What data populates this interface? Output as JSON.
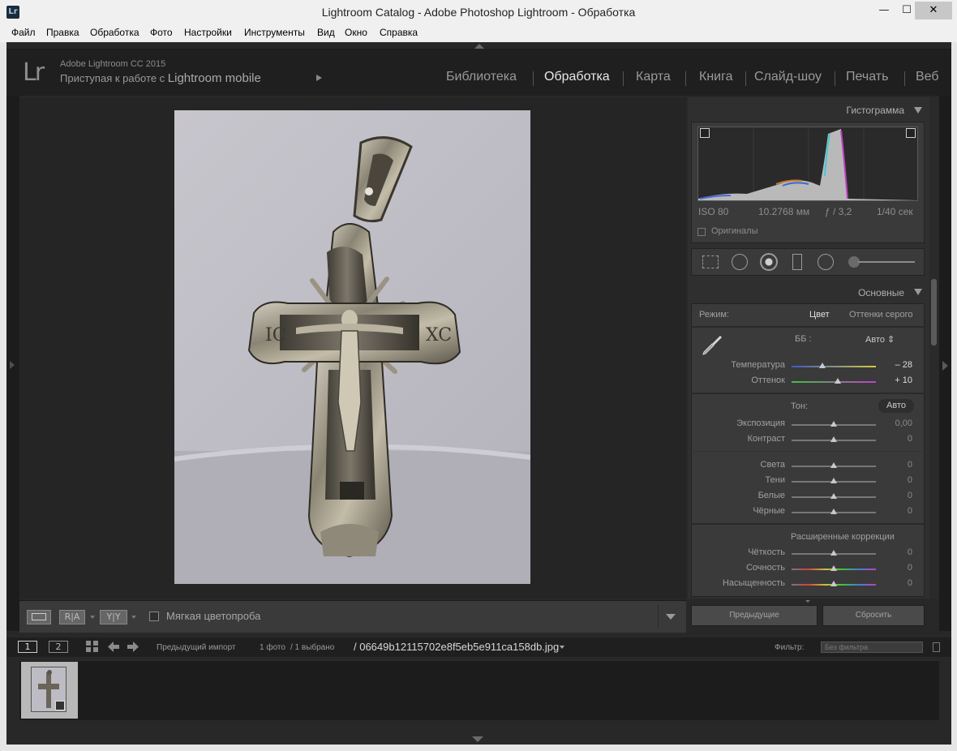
{
  "window": {
    "app_icon_text": "Lr",
    "title": "Lightroom Catalog - Adobe Photoshop Lightroom - Обработка",
    "minimize_glyph": "—",
    "maximize_glyph": "☐",
    "close_glyph": "✕"
  },
  "menu": [
    "Файл",
    "Правка",
    "Обработка",
    "Фото",
    "Настройки",
    "Инструменты",
    "Вид",
    "Окно",
    "Справка"
  ],
  "identity": {
    "logo": "Lr",
    "version": "Adobe Lightroom CC 2015",
    "tagline_prefix": "Приступая к работе с",
    "tagline_product": "Lightroom mobile"
  },
  "modules": [
    {
      "label": "Библиотека",
      "active": false
    },
    {
      "label": "Обработка",
      "active": true
    },
    {
      "label": "Карта",
      "active": false
    },
    {
      "label": "Книга",
      "active": false
    },
    {
      "label": "Слайд-шоу",
      "active": false
    },
    {
      "label": "Печать",
      "active": false
    },
    {
      "label": "Веб",
      "active": false
    }
  ],
  "toolbar": {
    "view_before_after_1": "R|A",
    "view_before_after_2": "Y|Y",
    "softproof_label": "Мягкая цветопроба",
    "softproof_checked": false
  },
  "histogram": {
    "title": "Гистограмма",
    "iso": "ISO 80",
    "focal": "10.2768 мм",
    "aperture": "ƒ / 3,2",
    "shutter": "1/40 сек",
    "originals_label": "Оригиналы"
  },
  "tools": [
    "crop-overlay-icon",
    "spot-removal-icon",
    "red-eye-icon",
    "graduated-filter-icon",
    "radial-filter-icon",
    "adjustment-brush-icon"
  ],
  "basic": {
    "title": "Основные",
    "mode_label": "Режим:",
    "mode_color": "Цвет",
    "mode_gray": "Оттенки серого",
    "wb_label": "ББ :",
    "wb_value": "Авто ⇕",
    "tone_label": "Тон:",
    "tone_auto": "Авто",
    "advanced_label": "Расширенные коррекции",
    "wb_sliders": [
      {
        "label": "Температура",
        "value": "– 28",
        "pos": 0.37
      },
      {
        "label": "Оттенок",
        "value": "+ 10",
        "pos": 0.55
      }
    ],
    "tone_sliders_1": [
      {
        "label": "Экспозиция",
        "value": "0,00",
        "pos": 0.5
      },
      {
        "label": "Контраст",
        "value": "0",
        "pos": 0.5
      }
    ],
    "tone_sliders_2": [
      {
        "label": "Света",
        "value": "0",
        "pos": 0.5
      },
      {
        "label": "Тени",
        "value": "0",
        "pos": 0.5
      },
      {
        "label": "Белые",
        "value": "0",
        "pos": 0.5
      },
      {
        "label": "Чёрные",
        "value": "0",
        "pos": 0.5
      }
    ],
    "presence_sliders": [
      {
        "label": "Чёткость",
        "value": "0",
        "pos": 0.5
      },
      {
        "label": "Сочность",
        "value": "0",
        "pos": 0.5
      },
      {
        "label": "Насыщенность",
        "value": "0",
        "pos": 0.5
      }
    ]
  },
  "panel_buttons": {
    "previous": "Предыдущие",
    "reset": "Сбросить"
  },
  "filmstrip": {
    "monitor1": "1",
    "monitor2": "2",
    "source": "Предыдущий импорт",
    "count": "1 фото",
    "selected": "/ 1 выбрано",
    "filename": "/ 06649b12115702e8f5eb5e911ca158db.jpg",
    "filter_label": "Фильтр:",
    "filter_value": "Без фильтра"
  },
  "colors": {
    "accent_active": "#e8e8e8",
    "panel_bg": "#3a3a3a",
    "app_bg": "#282828"
  }
}
